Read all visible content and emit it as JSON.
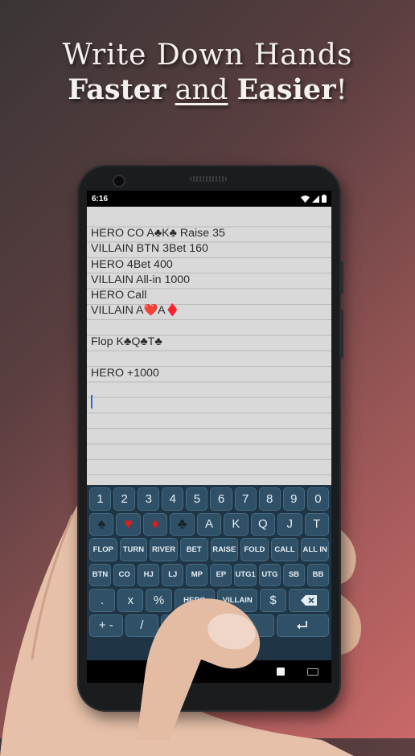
{
  "headline": {
    "line1": "Write Down Hands",
    "faster": "Faster",
    "and": "and",
    "easier": "Easier",
    "exclaim": "!"
  },
  "status_bar": {
    "time": "6:16"
  },
  "notes": [
    "HERO CO A♣K♣ Raise 35",
    "VILLAIN BTN 3Bet 160",
    "HERO 4Bet 400",
    "VILLAIN All-in 1000",
    "HERO Call",
    "VILLAIN A❤️A♦️",
    "",
    "Flop K♣Q♣T♣",
    "",
    "HERO +1000"
  ],
  "keyboard": {
    "row1": [
      "1",
      "2",
      "3",
      "4",
      "5",
      "6",
      "7",
      "8",
      "9",
      "0"
    ],
    "row2_suits": [
      {
        "label": "♠",
        "icon": "spade-icon"
      },
      {
        "label": "♥",
        "icon": "heart-icon"
      },
      {
        "label": "♦",
        "icon": "diamond-icon"
      },
      {
        "label": "♣",
        "icon": "club-icon"
      }
    ],
    "row2_ranks": [
      "A",
      "K",
      "Q",
      "J",
      "T"
    ],
    "row3": [
      "FLOP",
      "TURN",
      "RIVER",
      "BET",
      "RAISE",
      "FOLD",
      "CALL",
      "ALL IN"
    ],
    "row4": [
      "BTN",
      "CO",
      "HJ",
      "LJ",
      "MP",
      "EP",
      "UTG1",
      "UTG",
      "SB",
      "BB"
    ],
    "row5": {
      "dot": ".",
      "x": "x",
      "percent": "%",
      "hero": "HERO",
      "villain": "VILLAIN",
      "dollar": "$",
      "backspace_icon": "backspace-icon"
    },
    "row6": {
      "plusminus": "+ -",
      "slash": "/",
      "enter_icon": "enter-icon"
    }
  },
  "colors": {
    "keyboard_bg": "#1f3546",
    "key_bg": "#2f5066",
    "suit_red": "#e21b1b"
  }
}
